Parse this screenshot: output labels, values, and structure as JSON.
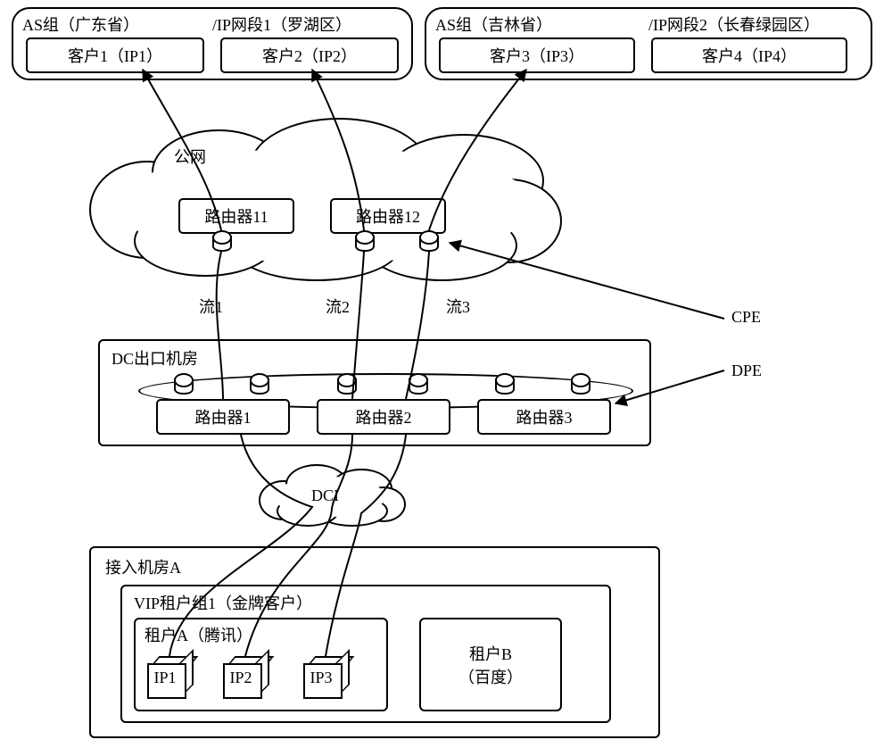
{
  "top_groups": [
    {
      "as_label": "AS组（广东省）",
      "ip_label": "/IP网段1（罗湖区）",
      "clients": [
        "客户1（IP1）",
        "客户2（IP2）"
      ]
    },
    {
      "as_label": "AS组（吉林省）",
      "ip_label": "/IP网段2（长春绿园区）",
      "clients": [
        "客户3（IP3）",
        "客户4（IP4）"
      ]
    }
  ],
  "public_net": {
    "label": "公网",
    "routers": [
      "路由器11",
      "路由器12"
    ]
  },
  "flows": [
    "流1",
    "流2",
    "流3"
  ],
  "dc_exit": {
    "title": "DC出口机房",
    "routers": [
      "路由器1",
      "路由器2",
      "路由器3"
    ]
  },
  "dci_label": "DCI",
  "access_room": {
    "title": "接入机房A",
    "vip_group": {
      "title": "VIP租户组1（金牌客户）",
      "tenant_a": {
        "title": "租户A（腾讯）",
        "ips": [
          "IP1",
          "IP2",
          "IP3"
        ]
      },
      "tenant_b": {
        "label": "租户B\n（百度）"
      }
    }
  },
  "side_labels": {
    "cpe": "CPE",
    "dpe": "DPE"
  },
  "chart_data": {
    "type": "diagram",
    "nodes": [
      {
        "id": "g1",
        "kind": "as-group",
        "label": "AS组（广东省）/IP网段1（罗湖区）",
        "children": [
          "c1",
          "c2"
        ]
      },
      {
        "id": "g2",
        "kind": "as-group",
        "label": "AS组（吉林省）/IP网段2（长春绿园区）",
        "children": [
          "c3",
          "c4"
        ]
      },
      {
        "id": "c1",
        "kind": "client",
        "label": "客户1（IP1）"
      },
      {
        "id": "c2",
        "kind": "client",
        "label": "客户2（IP2）"
      },
      {
        "id": "c3",
        "kind": "client",
        "label": "客户3（IP3）"
      },
      {
        "id": "c4",
        "kind": "client",
        "label": "客户4（IP4）"
      },
      {
        "id": "pn",
        "kind": "cloud",
        "label": "公网",
        "children": [
          "r11",
          "r12"
        ]
      },
      {
        "id": "r11",
        "kind": "router",
        "label": "路由器11",
        "role": "CPE"
      },
      {
        "id": "r12",
        "kind": "router",
        "label": "路由器12",
        "role": "CPE"
      },
      {
        "id": "dc",
        "kind": "room",
        "label": "DC出口机房",
        "children": [
          "r1",
          "r2",
          "r3"
        ]
      },
      {
        "id": "r1",
        "kind": "router",
        "label": "路由器1",
        "role": "DPE"
      },
      {
        "id": "r2",
        "kind": "router",
        "label": "路由器2",
        "role": "DPE"
      },
      {
        "id": "r3",
        "kind": "router",
        "label": "路由器3",
        "role": "DPE"
      },
      {
        "id": "dci",
        "kind": "cloud",
        "label": "DCI"
      },
      {
        "id": "acc",
        "kind": "room",
        "label": "接入机房A",
        "children": [
          "vip"
        ]
      },
      {
        "id": "vip",
        "kind": "group",
        "label": "VIP租户组1（金牌客户）",
        "children": [
          "ta",
          "tb"
        ]
      },
      {
        "id": "ta",
        "kind": "tenant",
        "label": "租户A（腾讯）",
        "ips": [
          "IP1",
          "IP2",
          "IP3"
        ]
      },
      {
        "id": "tb",
        "kind": "tenant",
        "label": "租户B（百度）"
      }
    ],
    "edges": [
      {
        "id": "flow1",
        "label": "流1",
        "path": [
          "ta.IP1",
          "dci",
          "r1",
          "r11",
          "c1"
        ]
      },
      {
        "id": "flow2",
        "label": "流2",
        "path": [
          "ta.IP2",
          "dci",
          "r2",
          "r12",
          "c2"
        ]
      },
      {
        "id": "flow3",
        "label": "流3",
        "path": [
          "ta.IP3",
          "dci",
          "r2",
          "r12",
          "c3"
        ]
      },
      {
        "id": "cpe-ptr",
        "from": "label:CPE",
        "to": "r12"
      },
      {
        "id": "dpe-ptr",
        "from": "label:DPE",
        "to": "r3"
      }
    ]
  }
}
